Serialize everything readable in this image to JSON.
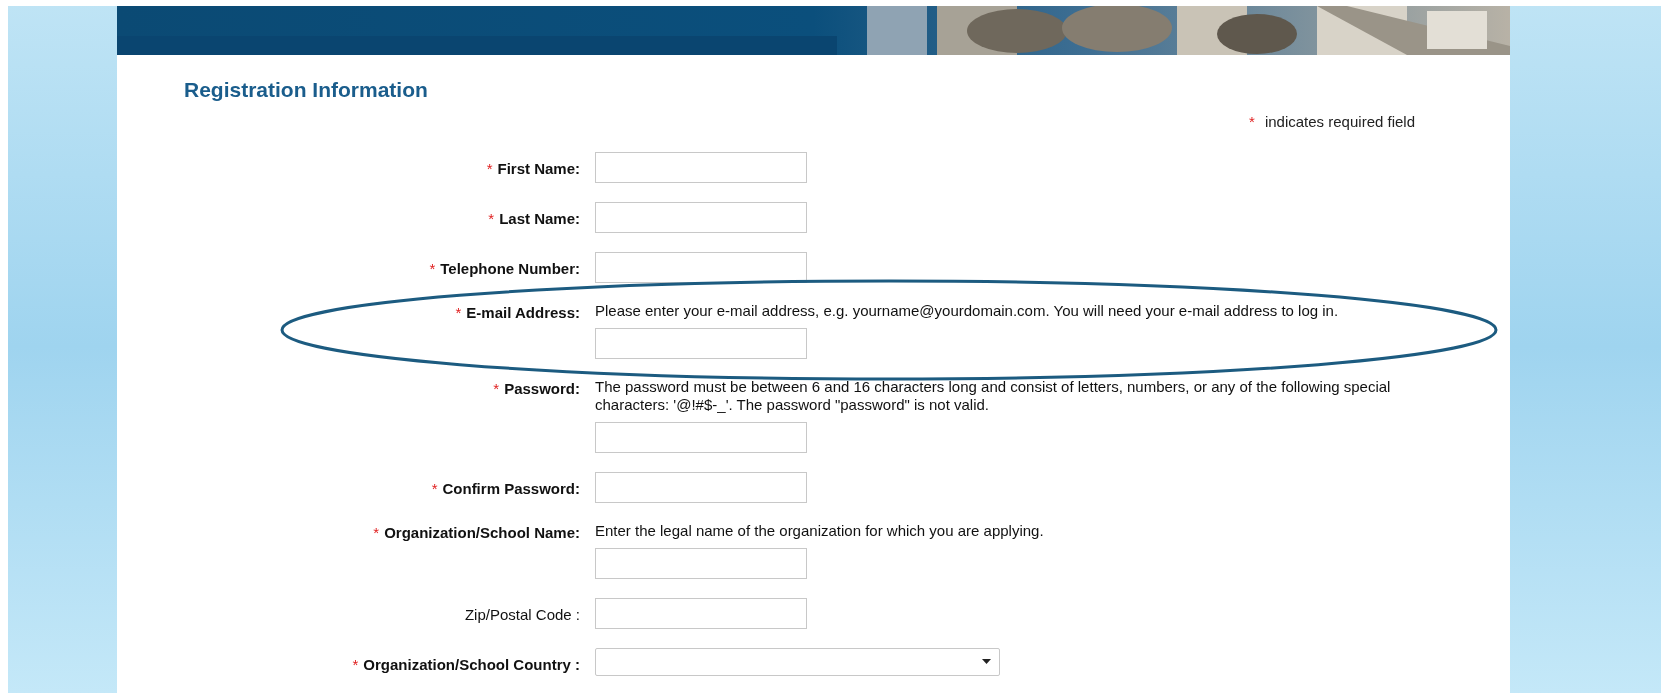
{
  "heading": "Registration Information",
  "required_note": {
    "mark": "*",
    "text": "indicates required field"
  },
  "fields": [
    {
      "label": "First Name:",
      "required": true,
      "kind": "text"
    },
    {
      "label": "Last Name:",
      "required": true,
      "kind": "text"
    },
    {
      "label": "Telephone Number:",
      "required": true,
      "kind": "text"
    },
    {
      "label": "E-mail Address:",
      "required": true,
      "kind": "text",
      "help": "Please enter your e-mail address, e.g. yourname@yourdomain.com. You will need your e-mail address to log in.",
      "highlighted": true
    },
    {
      "label": "Password:",
      "required": true,
      "kind": "text",
      "help": "The password must be between 6 and 16 characters long and consist of letters, numbers, or any of the following special characters: '@!#$-_'. The password \"password\" is not valid."
    },
    {
      "label": "Confirm Password:",
      "required": true,
      "kind": "text"
    },
    {
      "label": "Organization/School Name:",
      "required": true,
      "kind": "text",
      "help": "Enter the legal name of the organization for which you are applying."
    },
    {
      "label": "Zip/Postal Code :",
      "required": false,
      "kind": "text"
    },
    {
      "label": "Organization/School Country :",
      "required": true,
      "kind": "select"
    }
  ]
}
